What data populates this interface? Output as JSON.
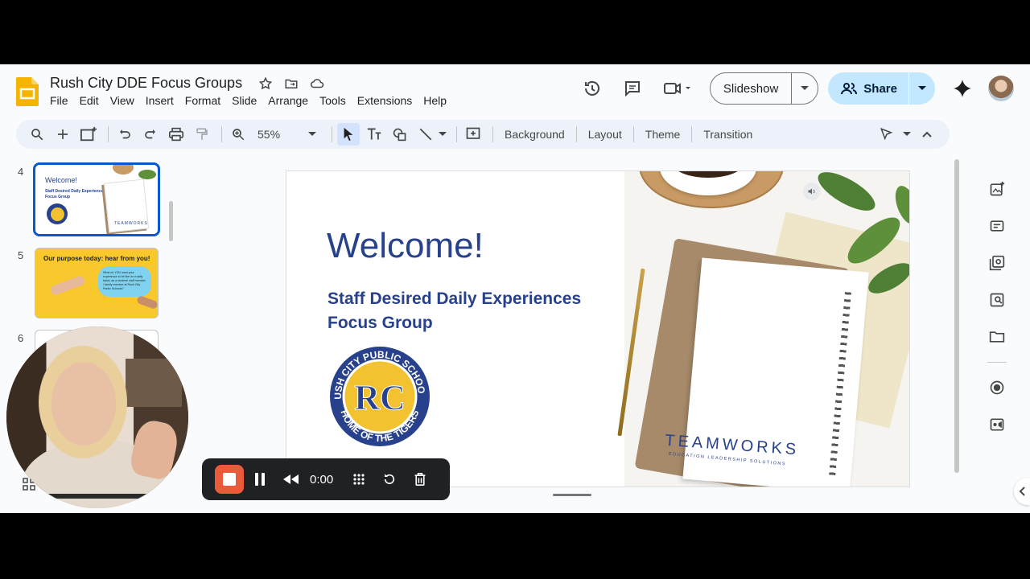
{
  "doc": {
    "title": "Rush City DDE  Focus Groups"
  },
  "menu": [
    "File",
    "Edit",
    "View",
    "Insert",
    "Format",
    "Slide",
    "Arrange",
    "Tools",
    "Extensions",
    "Help"
  ],
  "actions": {
    "slideshow": "Slideshow",
    "share": "Share"
  },
  "toolbar": {
    "zoom": "55%",
    "background": "Background",
    "layout": "Layout",
    "theme": "Theme",
    "transition": "Transition"
  },
  "filmstrip": {
    "slides": [
      {
        "num": "4",
        "title": "Welcome!",
        "subtitle": "Staff Desired Daily Experiences Focus Group",
        "brand": "TEAMWORKS"
      },
      {
        "num": "5",
        "title": "Our purpose today: hear from you!",
        "bubble": "What do YOU want your experience to be like on a daily basis, as a student/ staff member / family member at Rush City Public Schools?"
      },
      {
        "num": "6"
      }
    ]
  },
  "slide": {
    "title": "Welcome!",
    "subtitle_line1": "Staff Desired Daily Experiences",
    "subtitle_line2": "Focus Group",
    "seal": {
      "initials": "RC",
      "top_text": "RUSH CITY PUBLIC SCHOOLS",
      "bottom_text": "HOME OF THE TIGERS"
    },
    "brand": "TEAMWORKS",
    "brand_tagline": "EDUCATION LEADERSHIP SOLUTIONS"
  },
  "recorder": {
    "time": "0:00"
  },
  "colors": {
    "accent": "#0b57d0",
    "slide_blue": "#27418c",
    "seal_yellow": "#f2c230",
    "record": "#ea5b3a"
  }
}
